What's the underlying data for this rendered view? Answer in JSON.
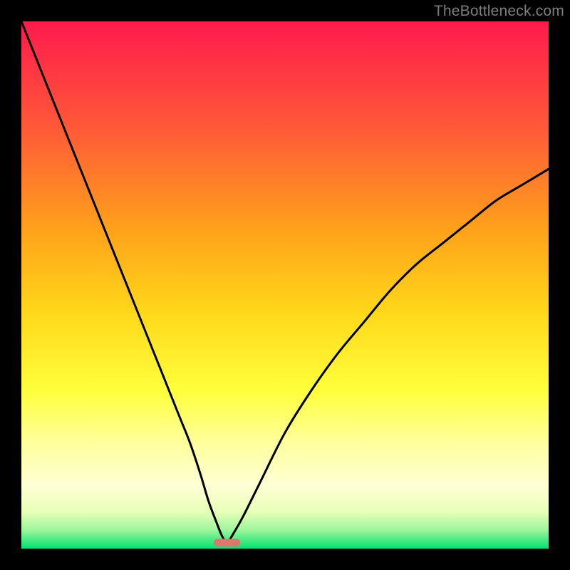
{
  "watermark": "TheBottleneck.com",
  "chart_data": {
    "type": "line",
    "title": "",
    "xlabel": "",
    "ylabel": "",
    "xlim": [
      0,
      100
    ],
    "ylim": [
      0,
      100
    ],
    "notch": {
      "x_center": 39,
      "x_halfwidth": 2.5,
      "y": 1.2
    },
    "gradient_stops": [
      {
        "offset": 0.0,
        "color": "#ff1a4d"
      },
      {
        "offset": 0.2,
        "color": "#ff5838"
      },
      {
        "offset": 0.4,
        "color": "#ffa31a"
      },
      {
        "offset": 0.55,
        "color": "#ffd71a"
      },
      {
        "offset": 0.7,
        "color": "#ffff3b"
      },
      {
        "offset": 0.8,
        "color": "#ffff9e"
      },
      {
        "offset": 0.88,
        "color": "#ffffd5"
      },
      {
        "offset": 0.93,
        "color": "#e8ffb8"
      },
      {
        "offset": 0.965,
        "color": "#9cf59c"
      },
      {
        "offset": 1.0,
        "color": "#00e270"
      }
    ],
    "series": [
      {
        "name": "left-curve",
        "x": [
          0,
          4,
          8,
          12,
          16,
          20,
          24,
          28,
          30,
          32,
          34,
          35.5,
          37,
          38,
          38.8
        ],
        "y": [
          100,
          90,
          80,
          70,
          60,
          50,
          40,
          30,
          25,
          20,
          14,
          9,
          5,
          2.5,
          1.2
        ]
      },
      {
        "name": "right-curve",
        "x": [
          39.2,
          40,
          42,
          45,
          50,
          55,
          60,
          65,
          70,
          75,
          80,
          85,
          90,
          95,
          100
        ],
        "y": [
          1.2,
          2.5,
          6,
          12,
          22,
          30,
          37,
          43,
          49,
          54,
          58,
          62,
          66,
          69,
          72
        ]
      }
    ]
  }
}
